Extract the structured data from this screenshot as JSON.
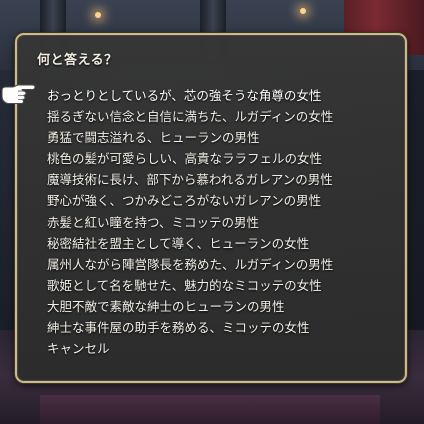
{
  "dialog": {
    "title": "何と答える？",
    "selected_index": 0,
    "choices": [
      "おっとりとしているが、芯の強そうな角尊の女性",
      "揺るぎない信念と自信に満ちた、ルガディンの女性",
      "勇猛で闘志溢れる、ヒューランの男性",
      "桃色の髪が可愛らしい、高貴なララフェルの女性",
      "魔導技術に長け、部下から慕われるガレアンの男性",
      "野心が強く、つかみどころがないガレアンの男性",
      "赤髪と紅い瞳を持つ、ミコッテの男性",
      "秘密結社を盟主として導く、ヒューランの女性",
      "属州人ながら陣営隊長を務めた、ルガディンの男性",
      "歌姫として名を馳せた、魅力的なミコッテの女性",
      "大胆不敵で素敵な紳士のヒューランの男性",
      "紳士な事件屋の助手を務める、ミコッテの女性",
      "キャンセル"
    ]
  },
  "cursor": {
    "icon": "pointing-hand-icon"
  },
  "colors": {
    "frame_border": "#cbb98f",
    "panel_bg": "#363636",
    "text": "#f2efe6"
  }
}
